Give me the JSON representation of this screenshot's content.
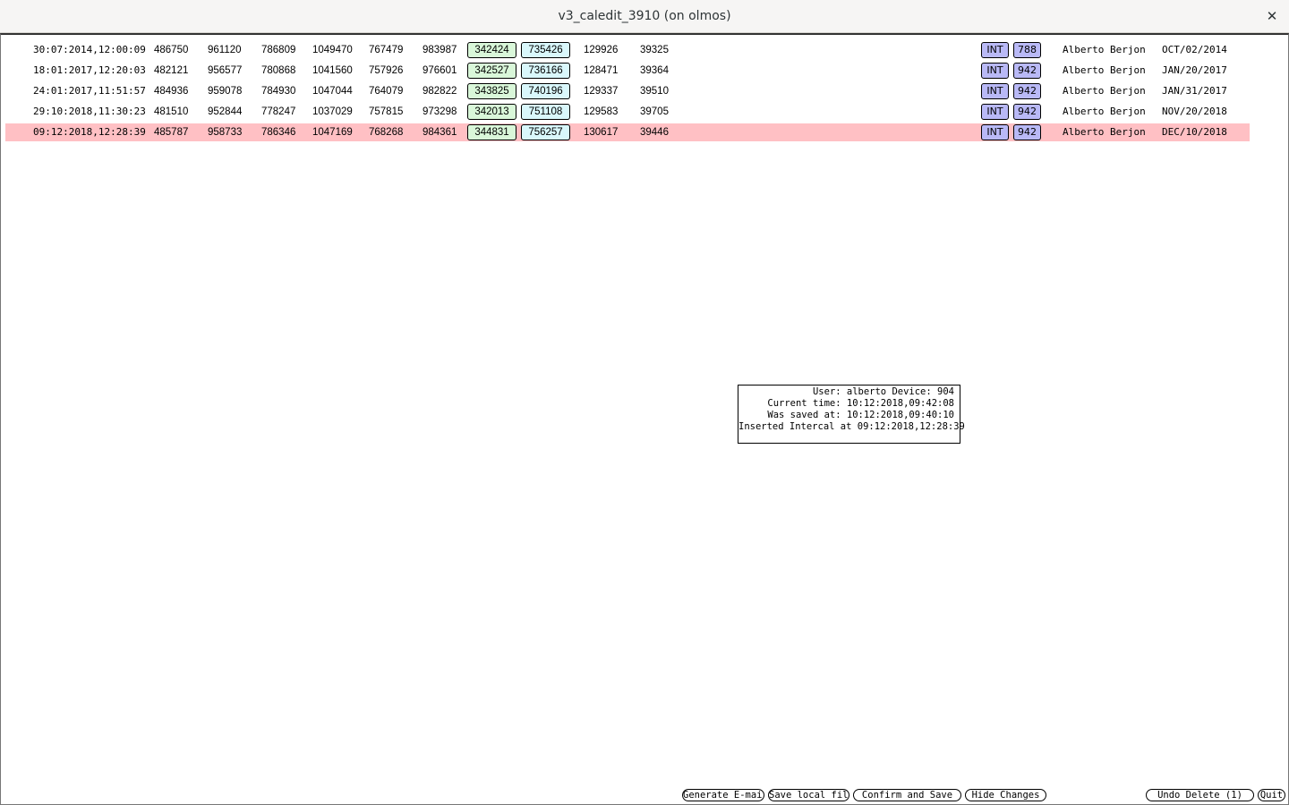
{
  "window": {
    "title": "v3_caledit_3910 (on olmos)",
    "close_glyph": "✕"
  },
  "rows": [
    {
      "datetime": "30:07:2014,12:00:09",
      "c1": "486750",
      "c2": "961120",
      "c3": "786809",
      "c4": "1049470",
      "c5": "767479",
      "c6": "983987",
      "green": "342424",
      "cyan": "735426",
      "c7": "129926",
      "c8": "39325",
      "type": "INT",
      "device": "788",
      "user": "Alberto Berjon",
      "date": "OCT/02/2014",
      "selected": false
    },
    {
      "datetime": "18:01:2017,12:20:03",
      "c1": "482121",
      "c2": "956577",
      "c3": "780868",
      "c4": "1041560",
      "c5": "757926",
      "c6": "976601",
      "green": "342527",
      "cyan": "736166",
      "c7": "128471",
      "c8": "39364",
      "type": "INT",
      "device": "942",
      "user": "Alberto Berjon",
      "date": "JAN/20/2017",
      "selected": false
    },
    {
      "datetime": "24:01:2017,11:51:57",
      "c1": "484936",
      "c2": "959078",
      "c3": "784930",
      "c4": "1047044",
      "c5": "764079",
      "c6": "982822",
      "green": "343825",
      "cyan": "740196",
      "c7": "129337",
      "c8": "39510",
      "type": "INT",
      "device": "942",
      "user": "Alberto Berjon",
      "date": "JAN/31/2017",
      "selected": false
    },
    {
      "datetime": "29:10:2018,11:30:23",
      "c1": "481510",
      "c2": "952844",
      "c3": "778247",
      "c4": "1037029",
      "c5": "757815",
      "c6": "973298",
      "green": "342013",
      "cyan": "751108",
      "c7": "129583",
      "c8": "39705",
      "type": "INT",
      "device": "942",
      "user": "Alberto Berjon",
      "date": "NOV/20/2018",
      "selected": false
    },
    {
      "datetime": "09:12:2018,12:28:39",
      "c1": "485787",
      "c2": "958733",
      "c3": "786346",
      "c4": "1047169",
      "c5": "768268",
      "c6": "984361",
      "green": "344831",
      "cyan": "756257",
      "c7": "130617",
      "c8": "39446",
      "type": "INT",
      "device": "942",
      "user": "Alberto Berjon",
      "date": "DEC/10/2018",
      "selected": true
    }
  ],
  "info": {
    "line1": "User: alberto Device: 904",
    "line2": "Current time: 10:12:2018,09:42:08",
    "line3": "Was saved at: 10:12:2018,09:40:10",
    "line4": "Inserted Intercal at 09:12:2018,12:28:39"
  },
  "buttons": {
    "generate_email": "Generate E-mail",
    "save_local": "Save local file",
    "confirm_save": "Confirm and Save",
    "hide_changes": "Hide Changes",
    "undo_delete": "Undo Delete (1)",
    "quit": "Quit"
  },
  "colors": {
    "selected_row": "#ffc0c4",
    "green_cell": "#d9f7d9",
    "cyan_cell": "#d9f7fb",
    "blue_tag": "#b9b9f6"
  }
}
